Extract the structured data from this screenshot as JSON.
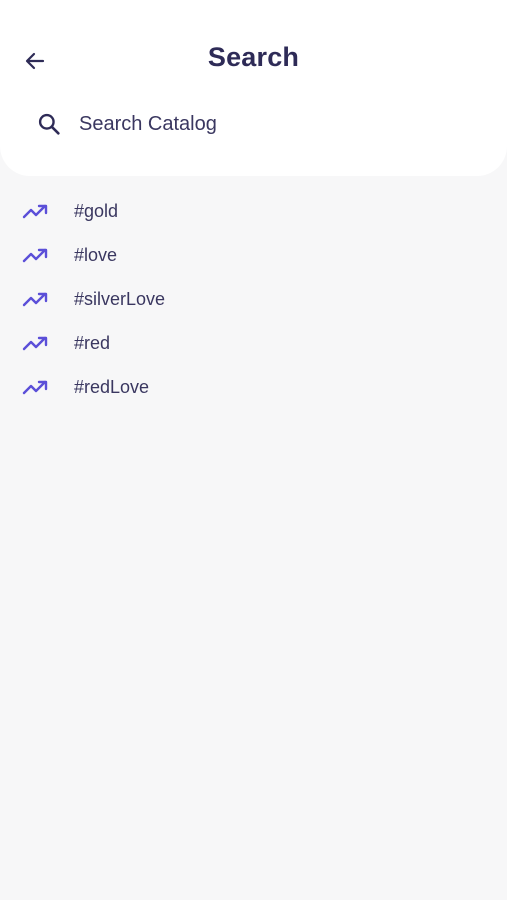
{
  "header": {
    "title": "Search"
  },
  "search": {
    "placeholder": "Search Catalog",
    "value": ""
  },
  "suggestions": {
    "items": [
      {
        "label": "#gold",
        "icon": "trending-up-icon"
      },
      {
        "label": "#love",
        "icon": "trending-up-icon"
      },
      {
        "label": "#silverLove",
        "icon": "trending-up-icon"
      },
      {
        "label": "#red",
        "icon": "trending-up-icon"
      },
      {
        "label": "#redLove",
        "icon": "trending-up-icon"
      }
    ]
  },
  "colors": {
    "text_primary": "#2e2b57",
    "accent": "#5b4fd8",
    "background": "#f7f7f8",
    "card": "#ffffff"
  }
}
